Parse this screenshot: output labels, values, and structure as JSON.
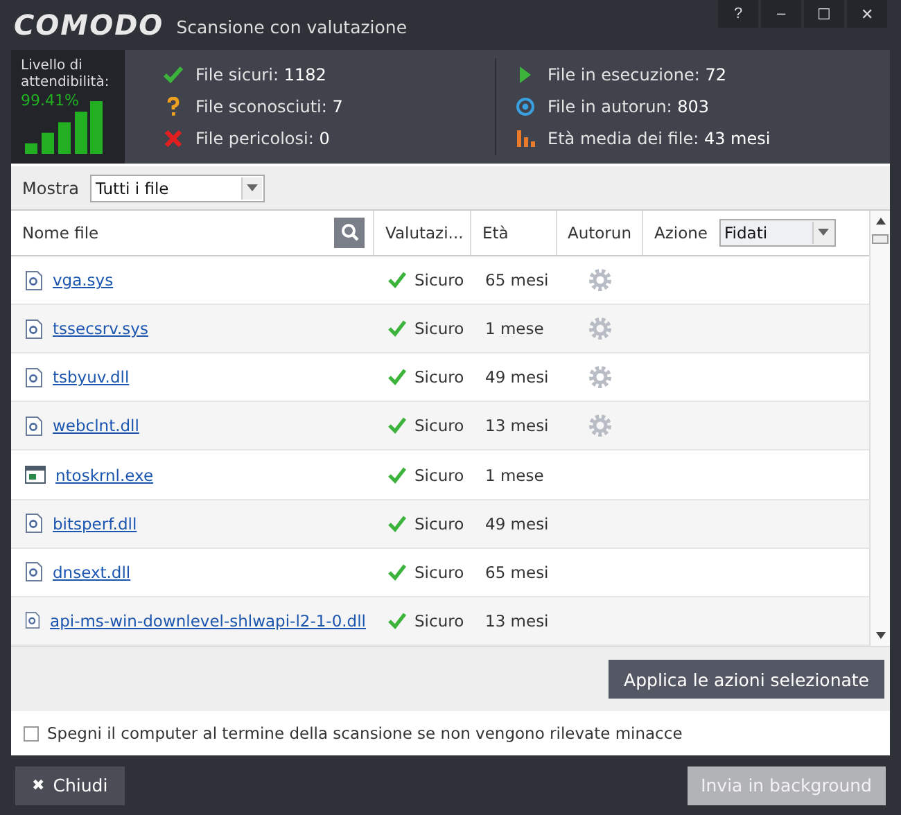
{
  "window": {
    "logo": "COMODO",
    "title": "Scansione con valutazione",
    "controls": [
      "?",
      "–",
      "☐",
      "✕"
    ]
  },
  "trust": {
    "label": "Livello di attendibilità:",
    "value": "99.41%"
  },
  "stats": [
    {
      "kind": "safe",
      "label": "File sicuri: ",
      "value": "1182"
    },
    {
      "kind": "unknown",
      "label": "File sconosciuti: ",
      "value": "7"
    },
    {
      "kind": "malicious",
      "label": "File pericolosi: ",
      "value": "0"
    },
    {
      "kind": "running",
      "label": "File in esecuzione: ",
      "value": "72"
    },
    {
      "kind": "autorun",
      "label": "File in autorun: ",
      "value": "803"
    },
    {
      "kind": "age",
      "label": "Età media dei file: ",
      "value": "43 mesi"
    }
  ],
  "filter": {
    "label": "Mostra",
    "value": "Tutti i file"
  },
  "table": {
    "columns": [
      "Nome file",
      "Valutazi...",
      "Età",
      "Autorun",
      "Azione"
    ],
    "action_value": "Fidati",
    "rows": [
      {
        "kind": "doc",
        "name": "vga.sys",
        "rating": "Sicuro",
        "age": "65 mesi",
        "autorun": true
      },
      {
        "kind": "doc",
        "name": "tssecsrv.sys",
        "rating": "Sicuro",
        "age": "1 mese",
        "autorun": true
      },
      {
        "kind": "doc",
        "name": "tsbyuv.dll",
        "rating": "Sicuro",
        "age": "49 mesi",
        "autorun": true
      },
      {
        "kind": "doc",
        "name": "webclnt.dll",
        "rating": "Sicuro",
        "age": "13 mesi",
        "autorun": true
      },
      {
        "kind": "app",
        "name": "ntoskrnl.exe",
        "rating": "Sicuro",
        "age": "1 mese",
        "autorun": false
      },
      {
        "kind": "doc",
        "name": "bitsperf.dll",
        "rating": "Sicuro",
        "age": "49 mesi",
        "autorun": false
      },
      {
        "kind": "doc",
        "name": "dnsext.dll",
        "rating": "Sicuro",
        "age": "65 mesi",
        "autorun": false
      },
      {
        "kind": "doc",
        "name": "api-ms-win-downlevel-shlwapi-l2-1-0.dll",
        "rating": "Sicuro",
        "age": "13 mesi",
        "autorun": false
      }
    ]
  },
  "apply_button": "Applica le azioni selezionate",
  "shutdown": {
    "label": "Spegni il computer al termine della scansione se non vengono rilevate minacce",
    "checked": false
  },
  "close_button": {
    "icon": "✖",
    "label": "Chiudi"
  },
  "background_button": {
    "label": "Invia in background",
    "disabled": true
  }
}
